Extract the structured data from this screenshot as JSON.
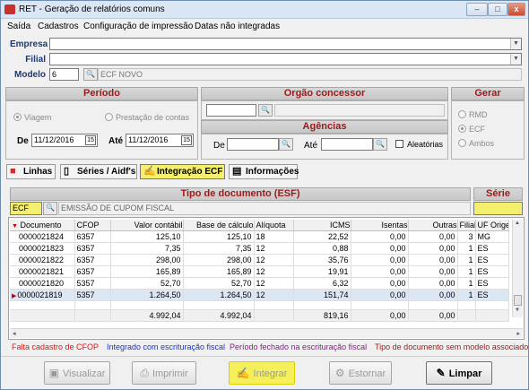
{
  "window": {
    "title": "RET - Geração de relatórios comuns",
    "min": "–",
    "max": "□",
    "close": "x"
  },
  "menu": [
    "Saída",
    "Cadastros",
    "Configuração de impressão",
    "Datas não integradas"
  ],
  "filters": {
    "empresa_label": "Empresa",
    "empresa_value": "",
    "filial_label": "Filial",
    "filial_value": "",
    "modelo_label": "Modelo",
    "modelo_code": "6",
    "modelo_desc": "ECF NOVO"
  },
  "periodo": {
    "header": "Período",
    "option_viagem": "Viagem",
    "option_prestacao": "Prestação de contas",
    "de_label": "De",
    "de_value": "11/12/2016",
    "ate_label": "Até",
    "ate_value": "11/12/2016",
    "cal_icon": "15"
  },
  "orgao": {
    "header": "Orgão concessor",
    "code": "",
    "desc": ""
  },
  "agencias": {
    "header": "Agências",
    "de_label": "De",
    "ate_label": "Até",
    "aleatorias_label": "Aleatórias"
  },
  "gerar": {
    "header": "Gerar",
    "options": [
      "RMD",
      "ECF",
      "Ambos"
    ]
  },
  "tabs": [
    "Linhas",
    "Séries / Aidf's",
    "Integração ECF",
    "Informações"
  ],
  "tipo_doc": {
    "header": "Tipo de documento (ESF)",
    "code": "ECF",
    "desc": "EMISSÃO DE CUPOM FISCAL"
  },
  "serie": {
    "header": "Série",
    "value": ""
  },
  "grid": {
    "columns": [
      "Documento",
      "CFOP",
      "Valor contábil",
      "Base de cálculo",
      "Alíquota",
      "ICMS",
      "Isentas",
      "Outras",
      "Filial",
      "UF Origem"
    ],
    "rows": [
      [
        "0000021824",
        "6357",
        "125,10",
        "125,10",
        "18",
        "22,52",
        "0,00",
        "0,00",
        "3",
        "MG"
      ],
      [
        "0000021823",
        "6357",
        "7,35",
        "7,35",
        "12",
        "0,88",
        "0,00",
        "0,00",
        "1",
        "ES"
      ],
      [
        "0000021822",
        "6357",
        "298,00",
        "298,00",
        "12",
        "35,76",
        "0,00",
        "0,00",
        "1",
        "ES"
      ],
      [
        "0000021821",
        "6357",
        "165,89",
        "165,89",
        "12",
        "19,91",
        "0,00",
        "0,00",
        "1",
        "ES"
      ],
      [
        "0000021820",
        "5357",
        "52,70",
        "52,70",
        "12",
        "6,32",
        "0,00",
        "0,00",
        "1",
        "ES"
      ],
      [
        "0000021819",
        "5357",
        "1.264,50",
        "1.264,50",
        "12",
        "151,74",
        "0,00",
        "0,00",
        "1",
        "ES"
      ]
    ],
    "totals": [
      "",
      "",
      "4.992,04",
      "4.992,04",
      "",
      "819,16",
      "0,00",
      "0,00",
      "",
      ""
    ]
  },
  "legend": [
    {
      "text": "Falta cadastro de CFOP",
      "color": "#d4181b"
    },
    {
      "text": "Integrado com escrituração fiscal",
      "color": "#1a35c8"
    },
    {
      "text": "Período fechado na escrituração fiscal",
      "color": "#8b1a8b"
    },
    {
      "text": "Tipo de documento sem modelo associado",
      "color": "#9a1b1b"
    }
  ],
  "buttons": [
    "Visualizar",
    "Imprimir",
    "Integrar",
    "Estornar",
    "Limpar"
  ],
  "colors": {
    "header_text": "#9a1b1b",
    "highlight": "#f5ef6e",
    "label_blue": "#1a3a7a"
  }
}
